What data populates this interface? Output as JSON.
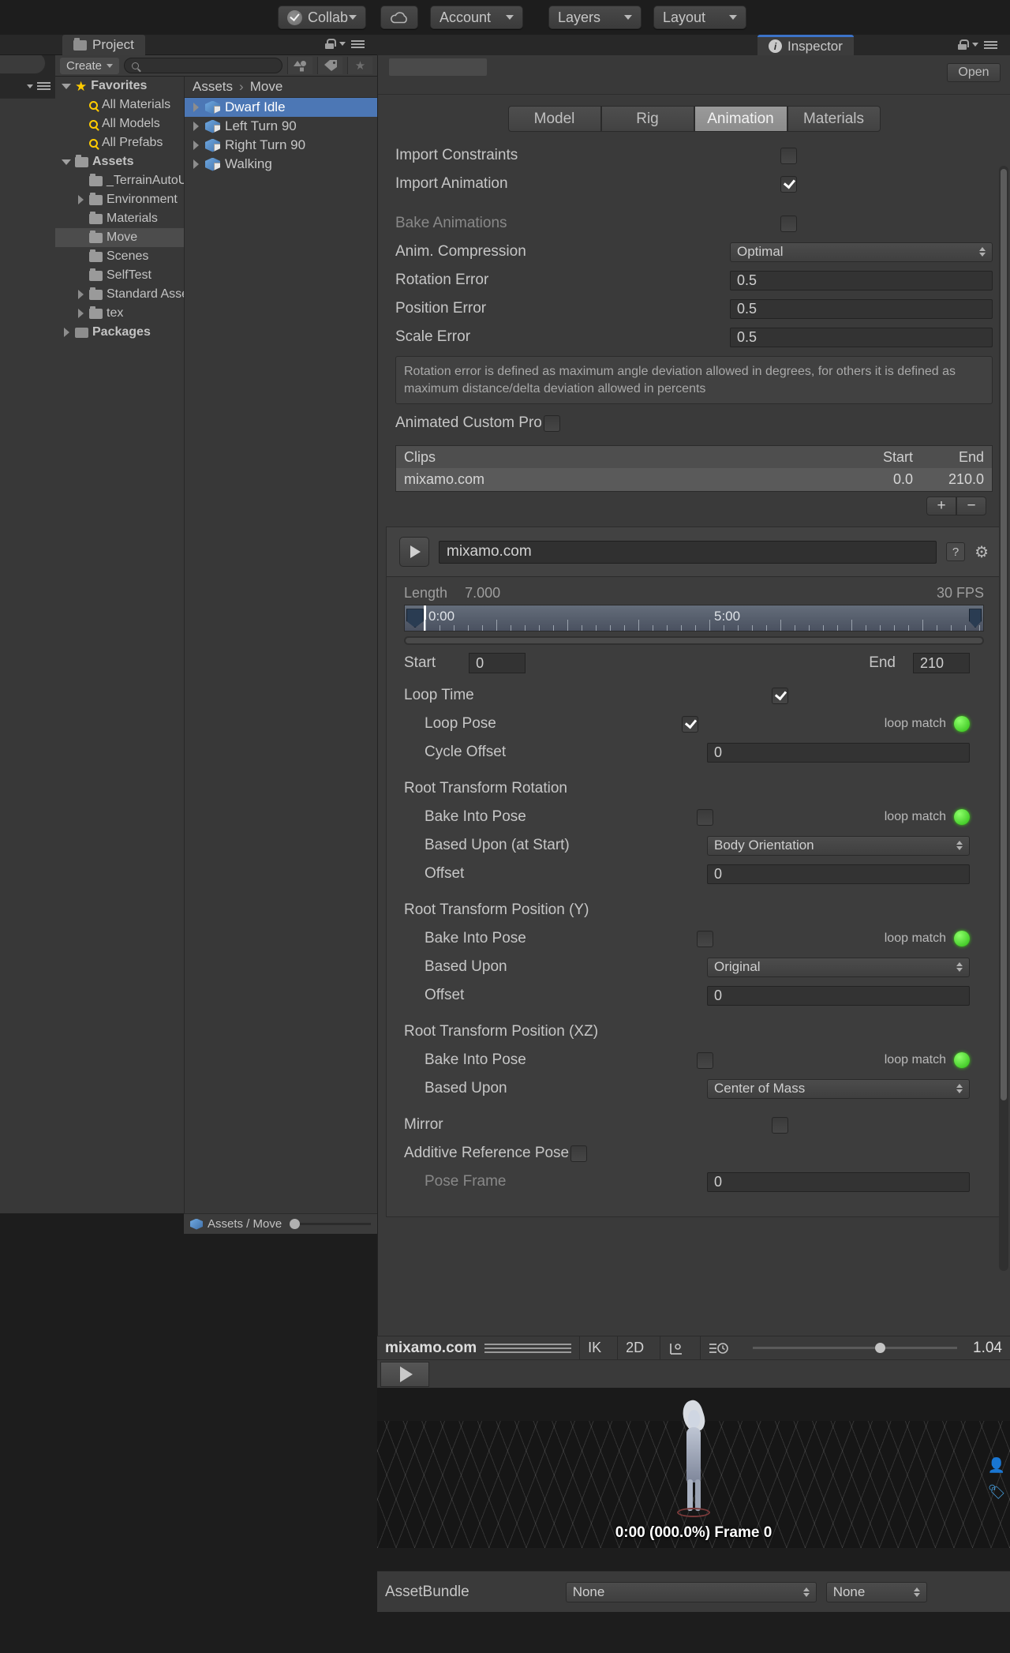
{
  "toolbar": {
    "collab": "Collab",
    "cloud_icon": "cloud-icon",
    "account": "Account",
    "layers": "Layers",
    "layout": "Layout"
  },
  "project_panel": {
    "tab_label": "Project",
    "create_label": "Create",
    "search_placeholder": "",
    "search_value": "",
    "tree": [
      {
        "label": "Favorites",
        "icon": "star-icon",
        "depth": 0,
        "twisty": "down",
        "bold": true
      },
      {
        "label": "All Materials",
        "icon": "search-icon",
        "depth": 1,
        "twisty": "none",
        "bold": false
      },
      {
        "label": "All Models",
        "icon": "search-icon",
        "depth": 1,
        "twisty": "none",
        "bold": false
      },
      {
        "label": "All Prefabs",
        "icon": "search-icon",
        "depth": 1,
        "twisty": "none",
        "bold": false
      },
      {
        "label": "Assets",
        "icon": "folder-icon",
        "depth": 0,
        "twisty": "down",
        "bold": true
      },
      {
        "label": "_TerrainAutoUpgrade",
        "icon": "folder-icon",
        "depth": 1,
        "twisty": "none",
        "bold": false
      },
      {
        "label": "Environment",
        "icon": "folder-icon",
        "depth": 1,
        "twisty": "right",
        "bold": false
      },
      {
        "label": "Materials",
        "icon": "folder-icon",
        "depth": 1,
        "twisty": "none",
        "bold": false
      },
      {
        "label": "Move",
        "icon": "folder-icon",
        "depth": 1,
        "twisty": "none",
        "bold": false,
        "selected": true
      },
      {
        "label": "Scenes",
        "icon": "folder-icon",
        "depth": 1,
        "twisty": "none",
        "bold": false
      },
      {
        "label": "SelfTest",
        "icon": "folder-icon",
        "depth": 1,
        "twisty": "none",
        "bold": false
      },
      {
        "label": "Standard Assets",
        "icon": "folder-icon",
        "depth": 1,
        "twisty": "right",
        "bold": false
      },
      {
        "label": "tex",
        "icon": "folder-icon",
        "depth": 1,
        "twisty": "right",
        "bold": false
      },
      {
        "label": "Packages",
        "icon": "package-icon",
        "depth": 0,
        "twisty": "right",
        "bold": true
      }
    ],
    "breadcrumb": {
      "root": "Assets",
      "chevron": "›",
      "leaf": "Move"
    },
    "assets": [
      {
        "label": "Dwarf Idle",
        "selected": true
      },
      {
        "label": "Left Turn 90",
        "selected": false
      },
      {
        "label": "Right Turn 90",
        "selected": false
      },
      {
        "label": "Walking",
        "selected": false
      }
    ],
    "statusbar": "Assets / Move"
  },
  "inspector": {
    "tab_label": "Inspector",
    "open_label": "Open",
    "tabs": [
      {
        "label": "Model",
        "active": false
      },
      {
        "label": "Rig",
        "active": false
      },
      {
        "label": "Animation",
        "active": true
      },
      {
        "label": "Materials",
        "active": false
      }
    ],
    "import_constraints": {
      "label": "Import Constraints",
      "checked": false
    },
    "import_animation": {
      "label": "Import Animation",
      "checked": true
    },
    "bake_animations": {
      "label": "Bake Animations",
      "checked": false,
      "disabled": true
    },
    "anim_compression": {
      "label": "Anim. Compression",
      "value": "Optimal"
    },
    "rotation_error": {
      "label": "Rotation Error",
      "value": "0.5"
    },
    "position_error": {
      "label": "Position Error",
      "value": "0.5"
    },
    "scale_error": {
      "label": "Scale Error",
      "value": "0.5"
    },
    "help_text": "Rotation error is defined as maximum angle deviation allowed in degrees, for others it is defined as maximum distance/delta deviation allowed in percents",
    "animated_custom_pro": {
      "label": "Animated Custom Pro",
      "checked": false
    },
    "clips": {
      "header": {
        "name": "Clips",
        "start": "Start",
        "end": "End"
      },
      "rows": [
        {
          "name": "mixamo.com",
          "start": "0.0",
          "end": "210.0"
        }
      ],
      "add_label": "+",
      "remove_label": "−"
    },
    "clip_editor": {
      "name": "mixamo.com",
      "length_label": "Length",
      "length_value": "7.000",
      "fps": "30 FPS",
      "ruler_start_label": "0:00",
      "ruler_mid_label": "5:00",
      "start_label": "Start",
      "start_value": "0",
      "end_label": "End",
      "end_value": "210",
      "loop_time": {
        "label": "Loop Time",
        "checked": true
      },
      "loop_pose": {
        "label": "Loop Pose",
        "checked": true,
        "match": "loop match"
      },
      "cycle_offset": {
        "label": "Cycle Offset",
        "value": "0"
      },
      "root_rotation": {
        "title": "Root Transform Rotation",
        "bake_into_pose": {
          "label": "Bake Into Pose",
          "checked": false,
          "match": "loop match"
        },
        "based_upon": {
          "label": "Based Upon (at Start)",
          "value": "Body Orientation"
        },
        "offset": {
          "label": "Offset",
          "value": "0"
        }
      },
      "root_pos_y": {
        "title": "Root Transform Position (Y)",
        "bake_into_pose": {
          "label": "Bake Into Pose",
          "checked": false,
          "match": "loop match"
        },
        "based_upon": {
          "label": "Based Upon",
          "value": "Original"
        },
        "offset": {
          "label": "Offset",
          "value": "0"
        }
      },
      "root_pos_xz": {
        "title": "Root Transform Position (XZ)",
        "bake_into_pose": {
          "label": "Bake Into Pose",
          "checked": false,
          "match": "loop match"
        },
        "based_upon": {
          "label": "Based Upon",
          "value": "Center of Mass"
        }
      },
      "mirror": {
        "label": "Mirror",
        "checked": false
      },
      "additive_reference_pose": {
        "label": "Additive Reference Pose",
        "checked": false
      },
      "pose_frame": {
        "label": "Pose Frame",
        "value": "0",
        "disabled": true
      }
    }
  },
  "preview": {
    "clip_name": "mixamo.com",
    "ik_label": "IK",
    "dimension_label": "2D",
    "pivot_icon": "pivot-icon",
    "speed_icon": "speed-icon",
    "speed_value": "1.04",
    "play_icon": "play-icon",
    "timecode": "0:00 (000.0%) Frame 0"
  },
  "footer": {
    "assetbundle_label": "AssetBundle",
    "assetbundle_value": "None",
    "variant_value": "None"
  },
  "colors": {
    "accent": "#3c73c8",
    "selection": "#4c77b5",
    "loop_match_green": "#2cbb13",
    "favorite_yellow": "#ffcc00"
  }
}
